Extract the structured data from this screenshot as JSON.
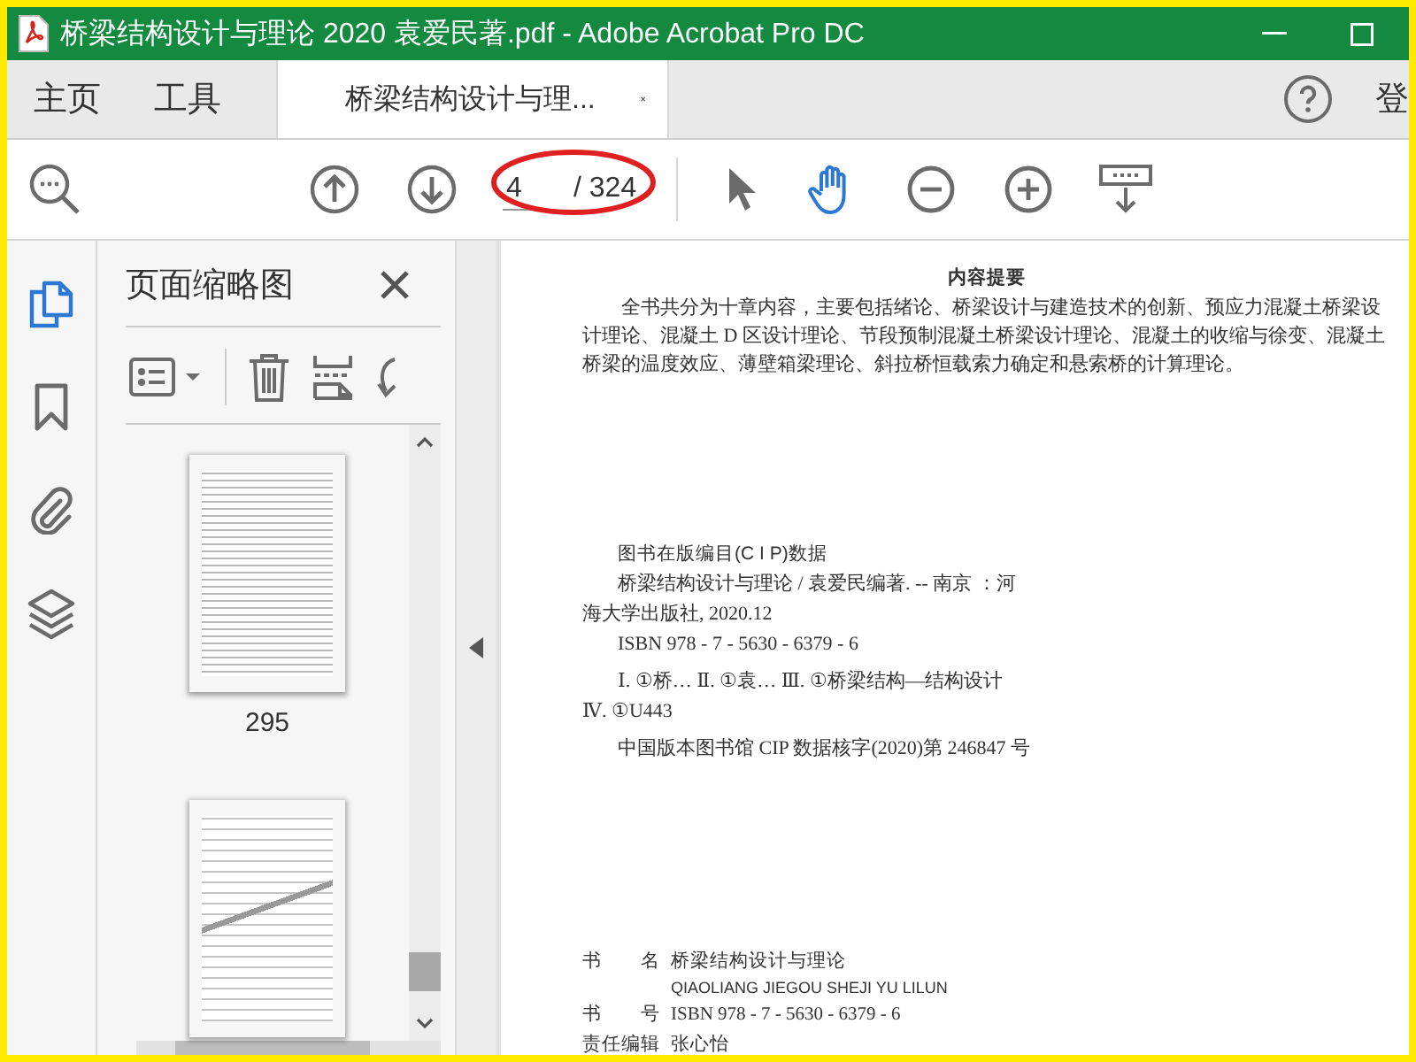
{
  "window": {
    "title": "桥梁结构设计与理论 2020 袁爱民著.pdf - Adobe Acrobat Pro DC"
  },
  "tabs": [
    {
      "label": "主页",
      "selected": false
    },
    {
      "label": "工具",
      "selected": false
    },
    {
      "label": "桥梁结构设计与理...",
      "selected": true
    }
  ],
  "account": {
    "label": "登"
  },
  "toolbar": {
    "page_value": "4",
    "page_total": "/ 324",
    "tools": [
      {
        "kind": "select",
        "selected": false
      },
      {
        "kind": "hand",
        "selected": true
      },
      {
        "kind": "zoom_out",
        "selected": false
      },
      {
        "kind": "zoom_in",
        "selected": false
      },
      {
        "kind": "read_mode",
        "selected": false
      }
    ]
  },
  "side_rail": [
    {
      "kind": "pages",
      "selected": true
    },
    {
      "kind": "bookmarks",
      "selected": false
    },
    {
      "kind": "attachments",
      "selected": false
    },
    {
      "kind": "layers",
      "selected": false
    }
  ],
  "panel": {
    "title": "页面缩略图",
    "thumbnails": [
      {
        "kind": "text",
        "label": "295"
      },
      {
        "kind": "diagram"
      }
    ]
  },
  "document": {
    "heading": "内容提要",
    "summary": "全书共分为十章内容，主要包括绪论、桥梁设计与建造技术的创新、预应力混凝土桥梁设计理论、混凝土 D 区设计理论、节段预制混凝土桥梁设计理论、混凝土的收缩与徐变、混凝土桥梁的温度效应、薄壁箱梁理论、斜拉桥恒载索力确定和悬索桥的计算理论。",
    "cip_heading": "图书在版编目(C I P)数据",
    "cip_lines": [
      {
        "kind": "indented",
        "text": "桥梁结构设计与理论 / 袁爱民编著. -- 南京 ：河"
      },
      {
        "kind": "continued",
        "text": "海大学出版社, 2020.12"
      },
      {
        "kind": "indented",
        "text": "ISBN 978 - 7 - 5630 - 6379 - 6"
      },
      {
        "kind": "indented",
        "text": "Ⅰ. ①桥… Ⅱ. ①袁… Ⅲ. ①桥梁结构—结构设计"
      },
      {
        "kind": "continued",
        "text": "Ⅳ. ①U443"
      },
      {
        "kind": "indented",
        "text": "中国版本图书馆 CIP 数据核字(2020)第 246847 号"
      }
    ],
    "colophon": [
      {
        "label": [
          "书",
          "名"
        ],
        "value": "桥梁结构设计与理论",
        "note": "QIAOLIANG JIEGOU SHEJI YU LILUN"
      },
      {
        "label": [
          "书",
          "号"
        ],
        "value": "ISBN 978 - 7 - 5630 - 6379 - 6"
      },
      {
        "label": [
          "责任编辑"
        ],
        "value": "张心怡"
      }
    ]
  }
}
